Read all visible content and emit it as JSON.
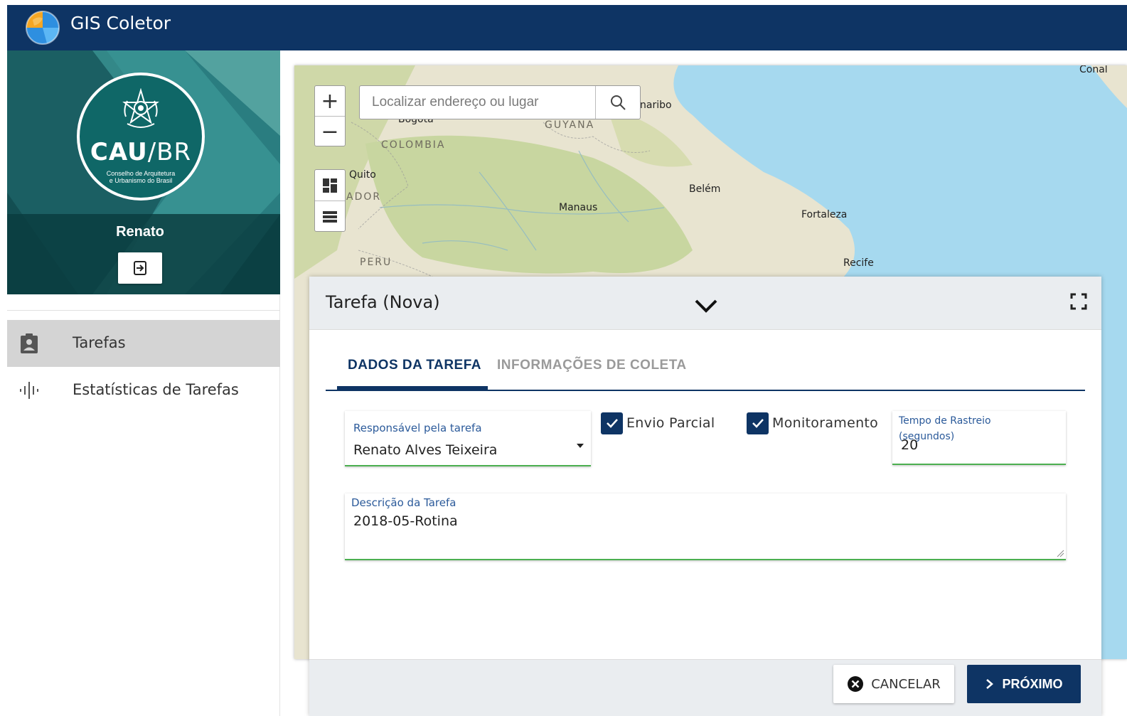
{
  "app": {
    "title": "GIS Coletor"
  },
  "sidebar": {
    "badge": {
      "title_bold": "CAU",
      "title_thin": "/BR",
      "subtitle": "Conselho de Arquitetura\ne Urbanismo do Brasil"
    },
    "user_name": "Renato",
    "items": [
      {
        "label": "Tarefas",
        "icon": "clipboard-icon",
        "active": true
      },
      {
        "label": "Estatísticas de Tarefas",
        "icon": "bar-pulse-icon",
        "active": false
      }
    ]
  },
  "map": {
    "search_placeholder": "Localizar endereço ou lugar",
    "places": {
      "conakry": "Conal",
      "paramaribo": "naribo",
      "bogota": "Bogotá",
      "guyana": "GUYANA",
      "colombia": "COLOMBIA",
      "quito": "Quito",
      "ecuador": "ADOR",
      "belem": "Belém",
      "manaus": "Manaus",
      "fortaleza": "Fortaleza",
      "peru": "PERU",
      "recife": "Recife"
    }
  },
  "panel": {
    "title": "Tarefa (Nova)",
    "tabs": [
      {
        "label": "DADOS DA TAREFA",
        "active": true
      },
      {
        "label": "INFORMAÇÕES DE COLETA",
        "active": false
      }
    ],
    "responsavel": {
      "label": "Responsável pela tarefa",
      "value": "Renato Alves Teixeira"
    },
    "envio_parcial": {
      "label": "Envio Parcial",
      "checked": true
    },
    "monitoramento": {
      "label": "Monitoramento",
      "checked": true
    },
    "tempo": {
      "label": "Tempo de Rastreio (segundos)",
      "value": "20"
    },
    "descricao": {
      "label": "Descrição da Tarefa",
      "value": "2018-05-Rotina"
    },
    "buttons": {
      "cancel": "CANCELAR",
      "next": "PRÓXIMO"
    }
  },
  "colors": {
    "primary": "#0e3464",
    "valid_underline": "#4caf50",
    "label_blue": "#2b5a9a"
  }
}
